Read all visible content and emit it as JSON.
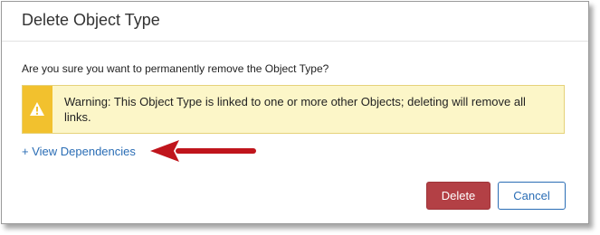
{
  "dialog": {
    "title": "Delete Object Type",
    "question": "Are you sure you want to permanently remove the Object Type?",
    "warning": {
      "icon": "warning-icon",
      "text": "Warning: This Object Type is linked to one or more other Objects; deleting will remove all links."
    },
    "dependencies_link": "+ View Dependencies",
    "annotation_arrow": {
      "icon": "red-arrow-left",
      "color": "#c0151c"
    },
    "buttons": {
      "delete_label": "Delete",
      "cancel_label": "Cancel"
    }
  },
  "colors": {
    "delete": "#b34045",
    "link": "#2a6db5",
    "warning_strip": "#f2c12e",
    "warning_bg": "#fcf6c8"
  }
}
